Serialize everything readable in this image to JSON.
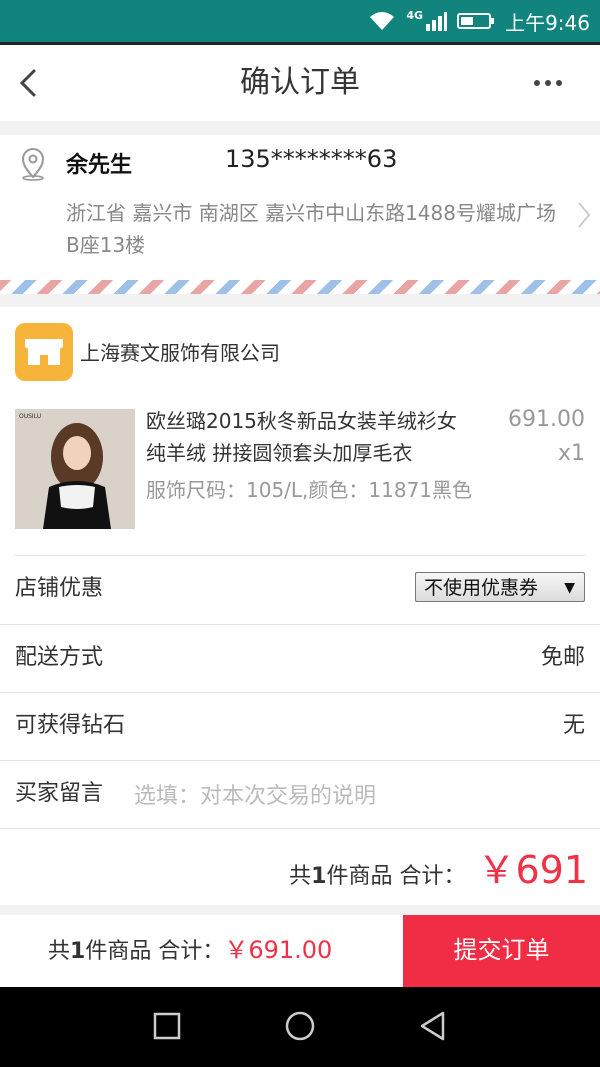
{
  "status_bar": {
    "network": "4G",
    "time": "上午9:46"
  },
  "nav": {
    "title": "确认订单",
    "back_icon": "back-chevron-icon",
    "more_icon": "more-dots-icon"
  },
  "address": {
    "name": "余先生",
    "phone": "135********63",
    "detail": "浙江省 嘉兴市 南湖区 嘉兴市中山东路1488号耀城广场B座13楼"
  },
  "shop": {
    "name": "上海赛文服饰有限公司",
    "icon": "shop-icon"
  },
  "product": {
    "title": "欧丝璐2015秋冬新品女装羊绒衫女 纯羊绒 拼接圆领套头加厚毛衣",
    "spec": "服饰尺码：105/L,颜色：11871黑色",
    "price": "691.00",
    "quantity": "x1",
    "image_brand": "OUSILU"
  },
  "rows": {
    "store_discount_label": "店铺优惠",
    "coupon_selected": "不使用优惠券",
    "delivery_label": "配送方式",
    "delivery_value": "免邮",
    "diamond_label": "可获得钻石",
    "diamond_value": "无",
    "message_label": "买家留言",
    "message_placeholder": "选填：对本次交易的说明"
  },
  "total": {
    "prefix": "共",
    "count": "1",
    "suffix": "件商品 合计：",
    "amount": "￥691"
  },
  "bottom_bar": {
    "prefix": "共",
    "count": "1",
    "suffix": "件商品 合计：",
    "amount": "￥691.00",
    "submit_label": "提交订单"
  },
  "colors": {
    "status_bar": "#11857d",
    "accent_red": "#f03146",
    "shop_icon": "#f6b53a"
  }
}
